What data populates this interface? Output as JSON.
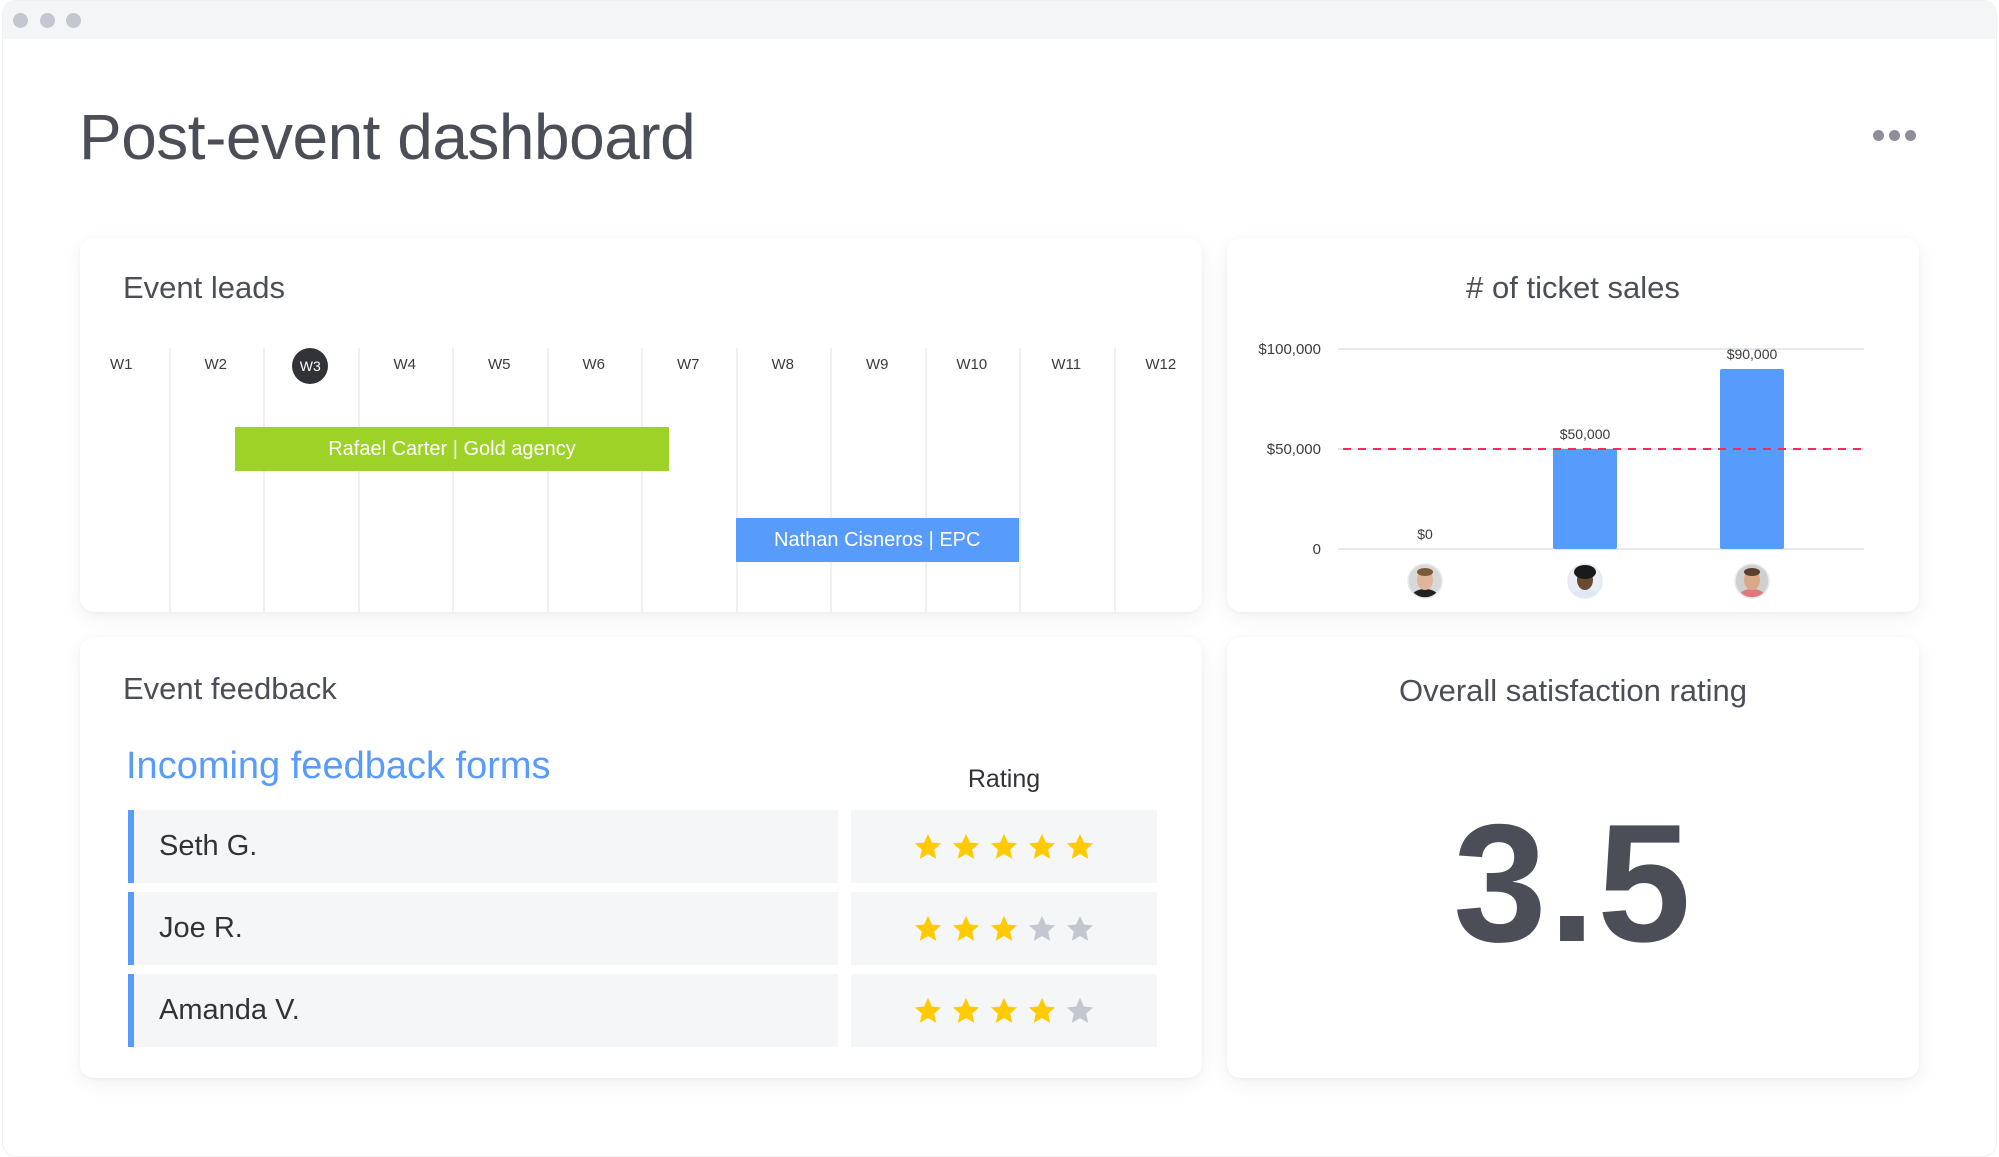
{
  "window": {
    "traffic_lights": [
      "close",
      "minimize",
      "maximize"
    ]
  },
  "header": {
    "title": "Post-event dashboard",
    "more_icon": "more-horizontal-icon"
  },
  "event_leads": {
    "title": "Event leads",
    "weeks": [
      "W1",
      "W2",
      "W3",
      "W4",
      "W5",
      "W6",
      "W7",
      "W8",
      "W9",
      "W10",
      "W11",
      "W12"
    ],
    "current_week": "W3",
    "bars": [
      {
        "label": "Rafael Carter | Gold agency",
        "start_week": 1.7,
        "end_week": 6.3,
        "color": "#9cd326"
      },
      {
        "label": "Nathan Cisneros | EPC",
        "start_week": 7.0,
        "end_week": 10.0,
        "color": "#579bfc"
      }
    ]
  },
  "ticket_sales": {
    "title": "# of ticket sales"
  },
  "chart_data": {
    "type": "bar",
    "title": "# of ticket sales",
    "categories": [
      "Person 1",
      "Person 2",
      "Person 3"
    ],
    "category_icons": [
      "avatar-man-short-hair",
      "avatar-woman-curly-hair",
      "avatar-man-beard"
    ],
    "values": [
      0,
      50000,
      90000
    ],
    "data_labels": [
      "$0",
      "$50,000",
      "$90,000"
    ],
    "y_ticks": [
      0,
      50000,
      100000
    ],
    "y_tick_labels": [
      "0",
      "$50,000",
      "$100,000"
    ],
    "ylim": [
      0,
      100000
    ],
    "xlabel": "",
    "ylabel": "",
    "grid": true,
    "target_line": {
      "value": 50000,
      "style": "dashed",
      "color": "#fb275d"
    },
    "bar_color": "#579bfc"
  },
  "feedback": {
    "title": "Event feedback",
    "subtitle": "Incoming feedback forms",
    "rating_header": "Rating",
    "max_rating": 5,
    "rows": [
      {
        "name": "Seth G.",
        "rating": 5
      },
      {
        "name": "Joe R.",
        "rating": 3
      },
      {
        "name": "Amanda V.",
        "rating": 4
      }
    ],
    "star_on_color": "#ffcb00",
    "star_off_color": "#c5c7d0"
  },
  "satisfaction": {
    "title": "Overall satisfaction rating",
    "value": "3.5"
  }
}
